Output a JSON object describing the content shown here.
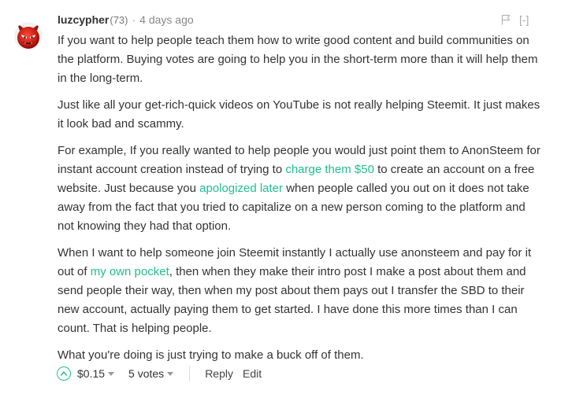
{
  "comment": {
    "author": "luzcypher",
    "reputation": "(73)",
    "separator": "·",
    "timestamp": "4 days ago",
    "collapse_label": "[-]",
    "paragraphs": [
      {
        "text": "If you want to help people teach them how to write good content and build communities on the platform. Buying votes are going to help you in the short-term more than it will help them in the long-term."
      },
      {
        "text": "Just like all your get-rich-quick videos on YouTube is not really helping Steemit. It just makes it look bad and scammy."
      },
      {
        "before_link_1": "For example, If you really wanted to help people you would just point them to AnonSteem for instant account creation instead of trying to ",
        "link_1": "charge them $50",
        "between_links": " to create an account on a free website. Just because you ",
        "link_2": "apologized later",
        "after_link_2": " when people called you out on it does not take away from the fact that you tried to capitalize on a new person coming to the platform and not knowing they had that option."
      },
      {
        "before_link": "When I want to help someone join Steemit instantly I actually use anonsteem and pay for it out of ",
        "link": "my own pocket",
        "after_link": ", then when they make their intro post I make a post about them and send people their way, then when my post about them pays out I transfer the SBD to their new account, actually paying them to get started. I have done this more times than I can count. That is helping people."
      },
      {
        "text": "What you're doing is just trying to make a buck off of them."
      }
    ],
    "footer": {
      "payout": "$0.15",
      "votes": "5 votes",
      "reply_label": "Reply",
      "edit_label": "Edit"
    }
  },
  "colors": {
    "link": "#1fbf8f",
    "text": "#333333",
    "muted": "#888888",
    "avatar": "#cc2222"
  },
  "icons": {
    "avatar": "red-devil-avatar",
    "flag": "flag-icon",
    "upvote": "upvote-chevron-icon",
    "dropdown": "caret-down-icon"
  }
}
